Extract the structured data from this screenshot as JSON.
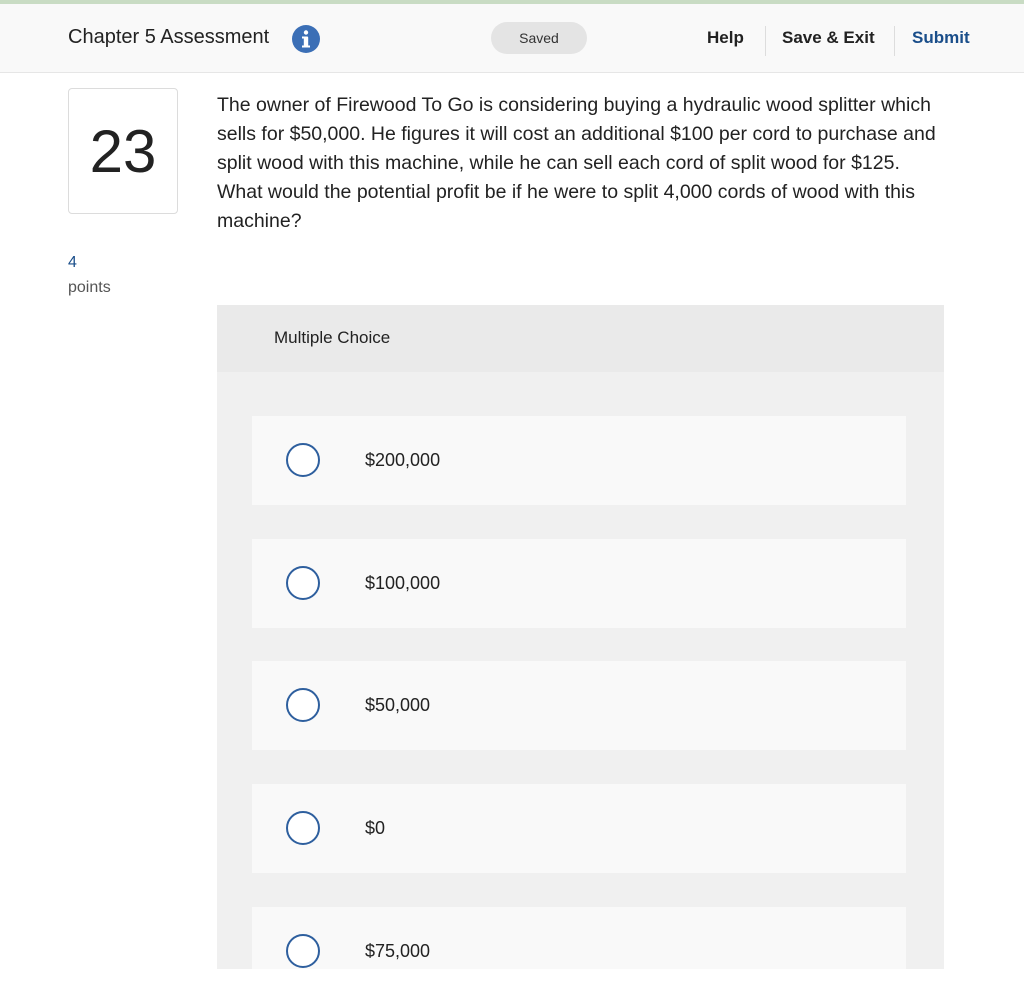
{
  "header": {
    "title": "Chapter 5 Assessment",
    "info_icon": "info-icon",
    "saved_status": "Saved",
    "help_label": "Help",
    "save_exit_label": "Save & Exit",
    "submit_label": "Submit"
  },
  "question": {
    "number": "23",
    "points_value": "4",
    "points_label": "points",
    "text": "The owner of Firewood To Go is considering buying a hydraulic wood splitter which sells for $50,000. He figures it will cost an additional $100 per cord to purchase and split wood with this machine, while he can sell each cord of split wood for $125. What would the potential profit be if he were to split 4,000 cords of wood with this machine?"
  },
  "multiple_choice": {
    "title": "Multiple Choice",
    "choices": [
      {
        "label": "$200,000",
        "selected": false
      },
      {
        "label": "$100,000",
        "selected": false
      },
      {
        "label": "$50,000",
        "selected": false
      },
      {
        "label": "$0",
        "selected": false
      },
      {
        "label": "$75,000",
        "selected": false
      }
    ]
  },
  "colors": {
    "accent": "#1a4e8a",
    "radio_border": "#2e5f9e",
    "info_icon": "#3b6fb6"
  }
}
